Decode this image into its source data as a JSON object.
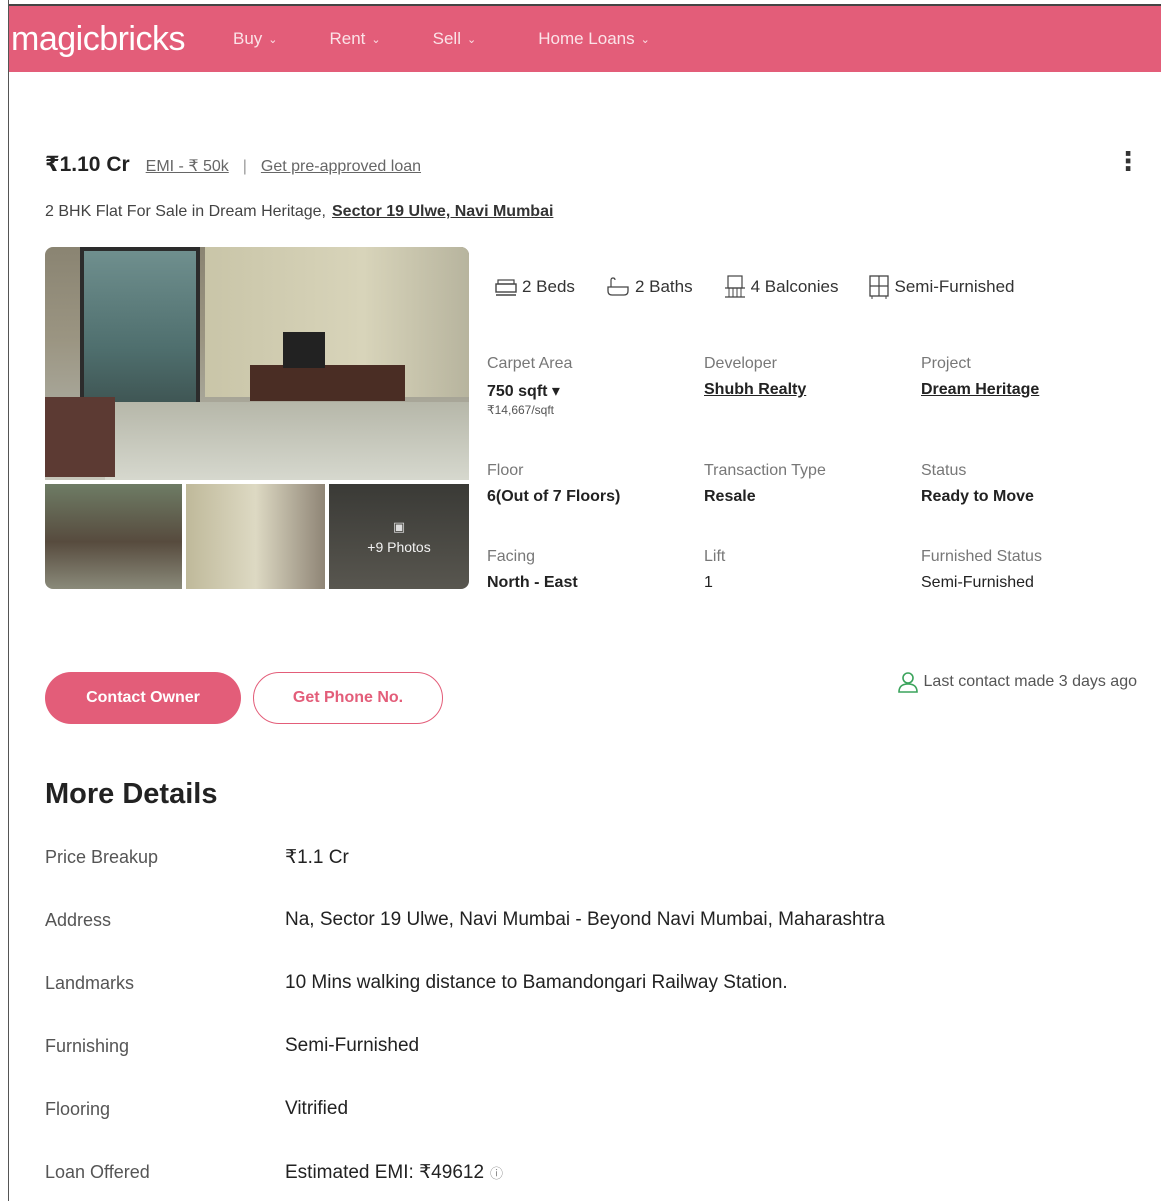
{
  "header": {
    "logo": "magicbricks",
    "nav": [
      {
        "label": "Buy"
      },
      {
        "label": "Rent"
      },
      {
        "label": "Sell"
      },
      {
        "label": "Home Loans"
      }
    ],
    "brand_color": "#e35d79"
  },
  "listing": {
    "price": "₹1.10 Cr",
    "emi_link": "EMI - ₹ 50k",
    "separator": "|",
    "preapproved_link": "Get pre-approved loan",
    "title": "2 BHK Flat For Sale in Dream Heritage,",
    "location": "Sector 19 Ulwe, Navi Mumbai",
    "more_photos": "+9 Photos"
  },
  "amenities": {
    "beds": "2 Beds",
    "baths": "2 Baths",
    "balconies": "4 Balconies",
    "furnishing": "Semi-Furnished"
  },
  "specs": {
    "carpet_area": {
      "label": "Carpet Area",
      "value": "750 sqft ▾",
      "sub": "₹14,667/sqft"
    },
    "developer": {
      "label": "Developer",
      "value": "Shubh Realty"
    },
    "project": {
      "label": "Project",
      "value": "Dream Heritage"
    },
    "floor": {
      "label": "Floor",
      "value": "6(Out of 7 Floors)"
    },
    "transaction": {
      "label": "Transaction Type",
      "value": "Resale"
    },
    "status": {
      "label": "Status",
      "value": "Ready to Move"
    },
    "facing": {
      "label": "Facing",
      "value": "North - East"
    },
    "lift": {
      "label": "Lift",
      "value": "1"
    },
    "furnished_status": {
      "label": "Furnished Status",
      "value": "Semi-Furnished"
    }
  },
  "actions": {
    "contact_owner": "Contact Owner",
    "get_phone": "Get Phone No.",
    "last_contact": "Last contact made 3 days ago"
  },
  "more_details": {
    "title": "More Details",
    "rows": [
      {
        "key": "Price Breakup",
        "value": "₹1.1 Cr"
      },
      {
        "key": "Address",
        "value": "Na, Sector 19 Ulwe, Navi Mumbai - Beyond Navi Mumbai, Maharashtra"
      },
      {
        "key": "Landmarks",
        "value": "10 Mins walking distance to Bamandongari Railway Station."
      },
      {
        "key": "Furnishing",
        "value": "Semi-Furnished"
      },
      {
        "key": "Flooring",
        "value": "Vitrified"
      },
      {
        "key": "Loan Offered",
        "value": "Estimated EMI: ₹49612"
      }
    ]
  }
}
